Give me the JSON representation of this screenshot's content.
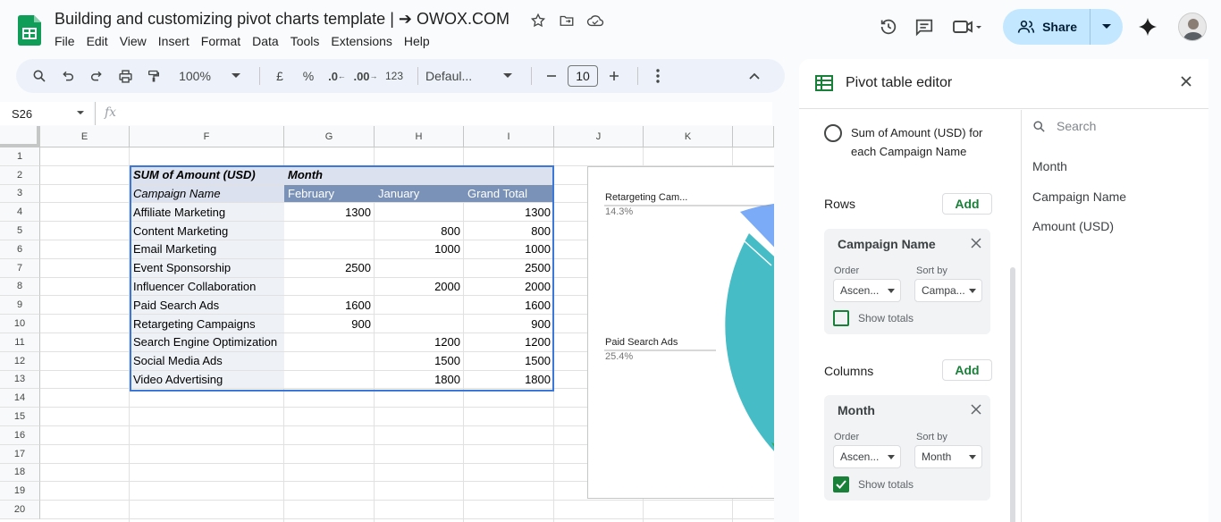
{
  "window": {
    "title": "Building and customizing pivot charts template | ➔ OWOX.COM",
    "menu": [
      "File",
      "Edit",
      "View",
      "Insert",
      "Format",
      "Data",
      "Tools",
      "Extensions",
      "Help"
    ],
    "share_label": "Share"
  },
  "toolbar": {
    "zoom": "100%",
    "currency": "£",
    "percent": "%",
    "decrease_decimal": ".0",
    "increase_decimal": ".00",
    "number_format": "123",
    "font": "Defaul...",
    "font_size": "10"
  },
  "formula_bar": {
    "name_box": "S26",
    "fx": "fx"
  },
  "grid": {
    "columns": [
      {
        "label": "E"
      },
      {
        "label": "F"
      },
      {
        "label": "G"
      },
      {
        "label": "H"
      },
      {
        "label": "I"
      },
      {
        "label": "J"
      },
      {
        "label": "K"
      }
    ],
    "rows": [
      "1",
      "2",
      "3",
      "4",
      "5",
      "6",
      "7",
      "8",
      "9",
      "10",
      "11",
      "12",
      "13",
      "14",
      "15",
      "16",
      "17",
      "18",
      "19",
      "20"
    ]
  },
  "pivot": {
    "header_value": "SUM of Amount (USD)",
    "header_col_group": "Month",
    "row_label": "Campaign Name",
    "col_headers": [
      "February",
      "January",
      "Grand Total"
    ],
    "rows": [
      {
        "name": "Affiliate Marketing",
        "feb": "1300",
        "jan": "",
        "total": "1300"
      },
      {
        "name": "Content Marketing",
        "feb": "",
        "jan": "800",
        "total": "800"
      },
      {
        "name": "Email Marketing",
        "feb": "",
        "jan": "1000",
        "total": "1000"
      },
      {
        "name": "Event Sponsorship",
        "feb": "2500",
        "jan": "",
        "total": "2500"
      },
      {
        "name": "Influencer Collaboration",
        "feb": "",
        "jan": "2000",
        "total": "2000"
      },
      {
        "name": "Paid Search Ads",
        "feb": "1600",
        "jan": "",
        "total": "1600"
      },
      {
        "name": "Retargeting Campaigns",
        "feb": "900",
        "jan": "",
        "total": "900"
      },
      {
        "name": "Search Engine Optimization",
        "feb": "",
        "jan": "1200",
        "total": "1200"
      },
      {
        "name": "Social Media Ads",
        "feb": "",
        "jan": "1500",
        "total": "1500"
      },
      {
        "name": "Video Advertising",
        "feb": "",
        "jan": "1800",
        "total": "1800"
      }
    ]
  },
  "chart_data": {
    "type": "pie",
    "labels": [
      {
        "name": "Retargeting Cam...",
        "pct": "14.3%"
      },
      {
        "name": "Paid Search Ads",
        "pct": "25.4%"
      }
    ],
    "colors": [
      "#46bdc6",
      "#7baaf7",
      "#34a853"
    ]
  },
  "editor": {
    "title": "Pivot table editor",
    "value_option": "Sum of Amount (USD) for each Campaign Name",
    "rows_title": "Rows",
    "columns_title": "Columns",
    "add_label": "Add",
    "rows_card": {
      "title": "Campaign Name",
      "order_label": "Order",
      "order_value": "Ascen...",
      "sort_label": "Sort by",
      "sort_value": "Campa...",
      "show_totals": "Show totals",
      "totals_checked": false
    },
    "columns_card": {
      "title": "Month",
      "order_label": "Order",
      "order_value": "Ascen...",
      "sort_label": "Sort by",
      "sort_value": "Month",
      "show_totals": "Show totals",
      "totals_checked": true
    },
    "search_placeholder": "Search",
    "fields": [
      "Month",
      "Campaign Name",
      "Amount (USD)"
    ]
  }
}
